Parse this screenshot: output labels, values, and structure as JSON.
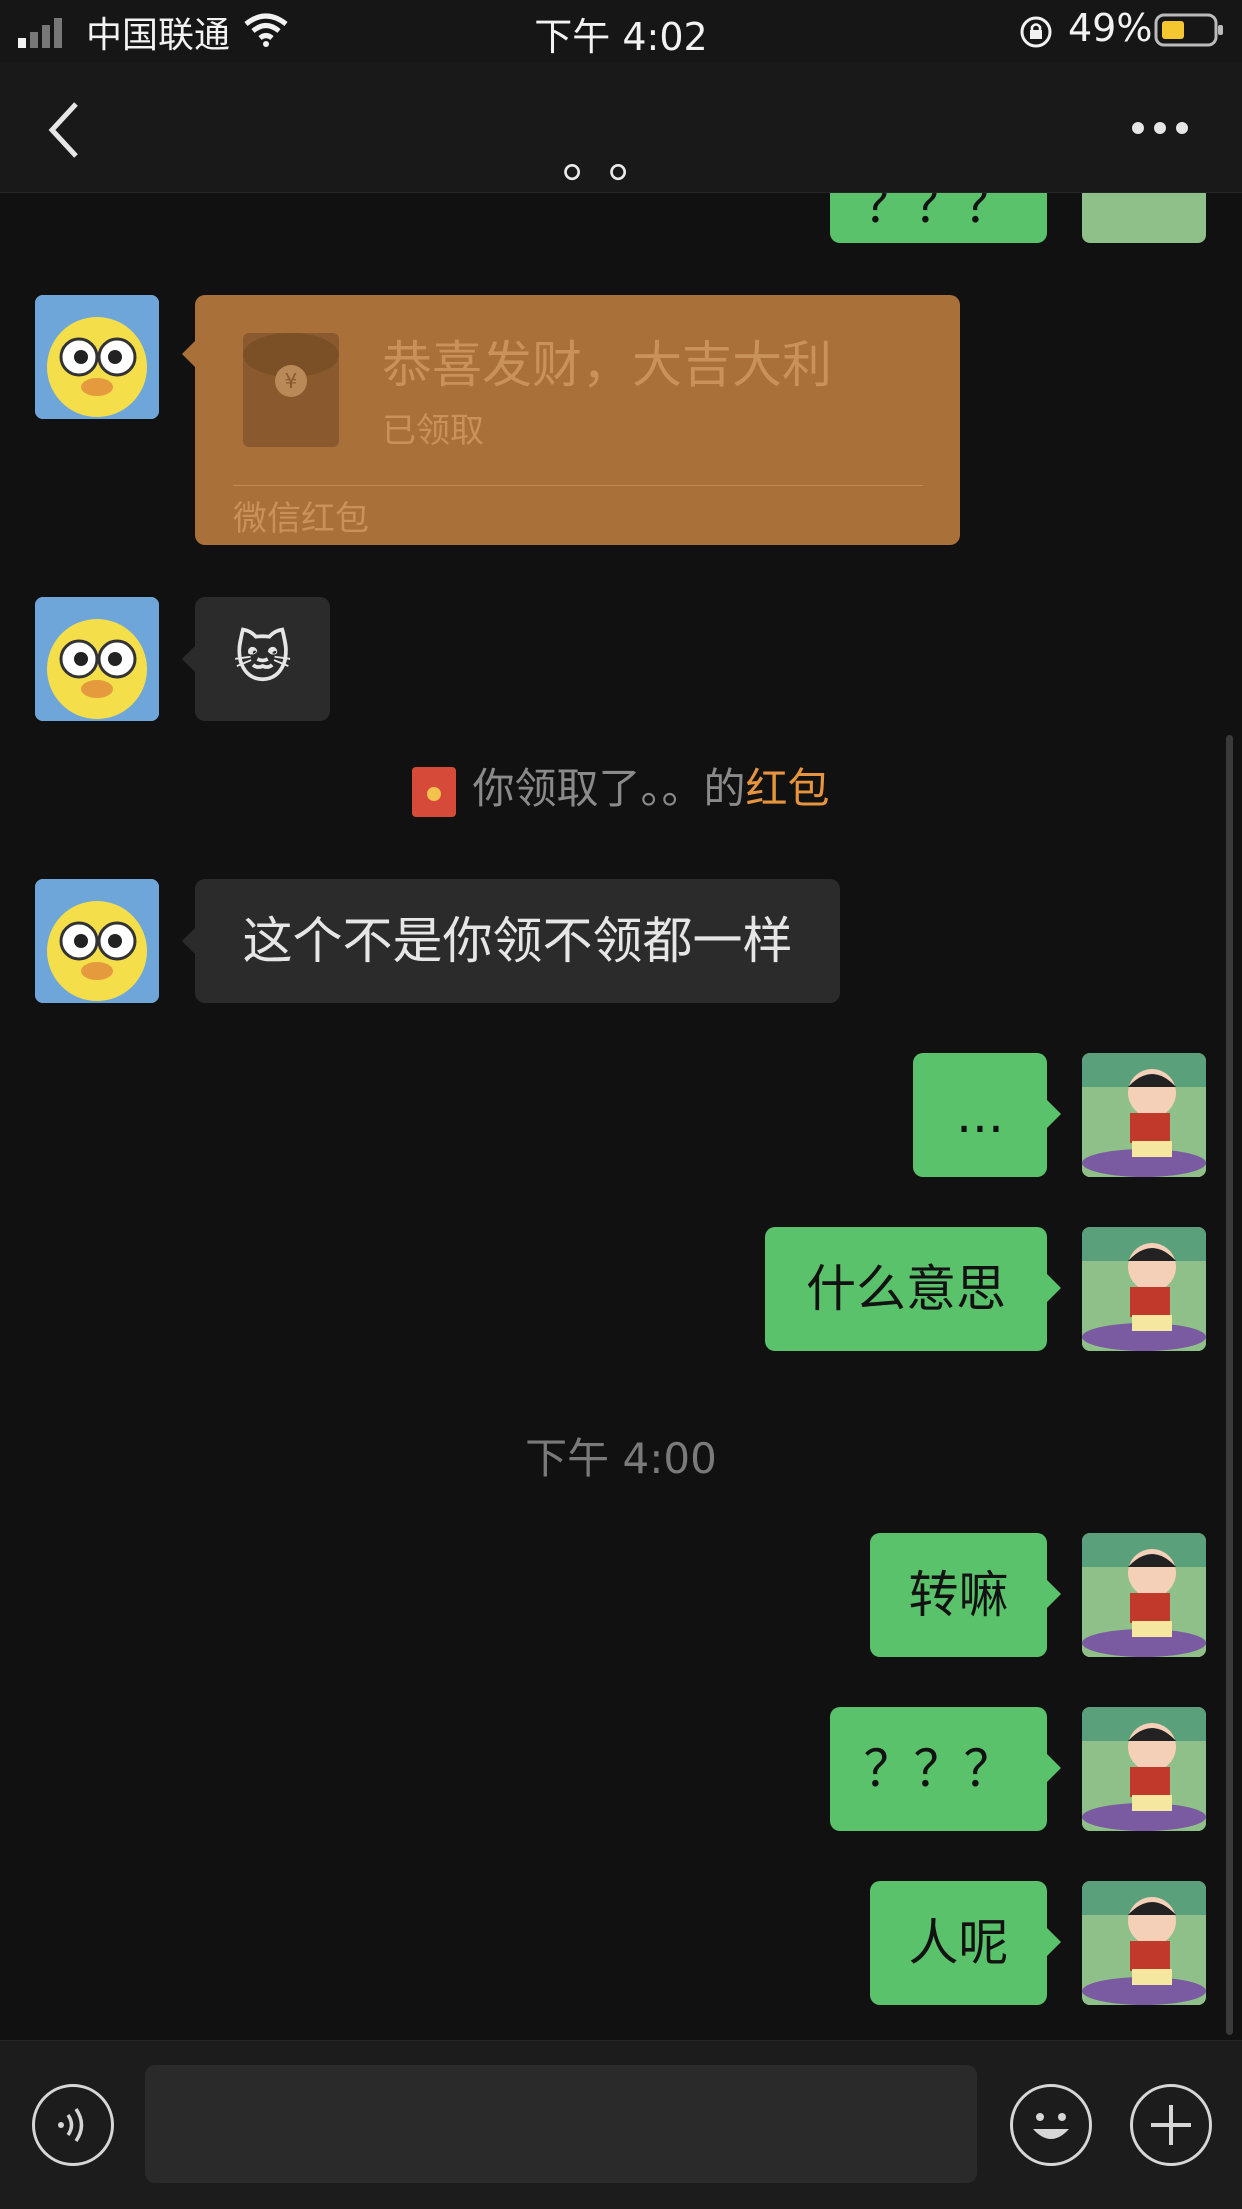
{
  "status_bar": {
    "carrier": "中国联通",
    "time": "下午 4:02",
    "battery_percent": "49%"
  },
  "nav": {
    "title": "。。"
  },
  "messages": [
    {
      "type": "bubble",
      "side": "right",
      "text": "？？？",
      "partial": true
    },
    {
      "type": "red_packet",
      "side": "left",
      "title": "恭喜发财，大吉大利",
      "status": "已领取",
      "label": "微信红包"
    },
    {
      "type": "sticker",
      "side": "left",
      "emoji": "🐱"
    },
    {
      "type": "system",
      "prefix": "你领取了。。的",
      "highlight": "红包"
    },
    {
      "type": "bubble",
      "side": "left",
      "text": "这个不是你领不领都一样"
    },
    {
      "type": "bubble",
      "side": "right",
      "text": "..."
    },
    {
      "type": "bubble",
      "side": "right",
      "text": "什么意思"
    },
    {
      "type": "timestamp",
      "text": "下午 4:00"
    },
    {
      "type": "bubble",
      "side": "right",
      "text": "转嘛"
    },
    {
      "type": "bubble",
      "side": "right",
      "text": "？？？"
    },
    {
      "type": "bubble",
      "side": "right",
      "text": "人呢"
    }
  ],
  "input_bar": {
    "voice_icon": "voice-icon",
    "emoji_icon": "smiley-icon",
    "plus_icon": "plus-icon"
  },
  "colors": {
    "background": "#111111",
    "bubble_out": "#5ac26a",
    "bubble_in": "#2b2b2b",
    "red_packet": "#a9703a",
    "highlight": "#e6953e"
  }
}
